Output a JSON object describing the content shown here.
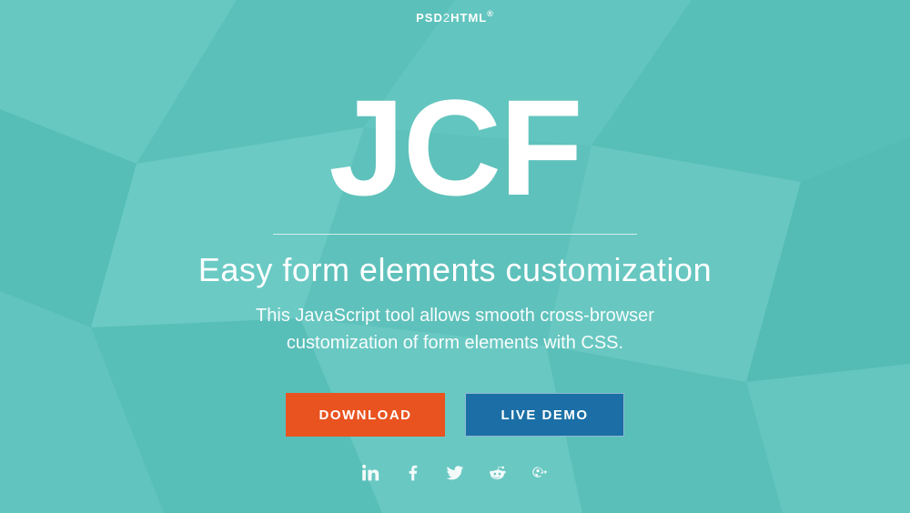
{
  "brand": {
    "part1": "PSD",
    "part2": "2",
    "part3": "HTML",
    "reg": "®"
  },
  "hero": {
    "logo": "JCF",
    "headline": "Easy form elements customization",
    "sub_line1": "This JavaScript tool allows smooth cross-browser",
    "sub_line2": "customization of form elements with CSS."
  },
  "cta": {
    "download": "DOWNLOAD",
    "demo": "LIVE DEMO"
  },
  "social": {
    "linkedin": "linkedin",
    "facebook": "facebook",
    "twitter": "twitter",
    "reddit": "reddit",
    "googleplus": "google-plus"
  },
  "colors": {
    "bg": "#5fc1bb",
    "primary": "#e9531f",
    "secondary": "#1b6fa6"
  }
}
